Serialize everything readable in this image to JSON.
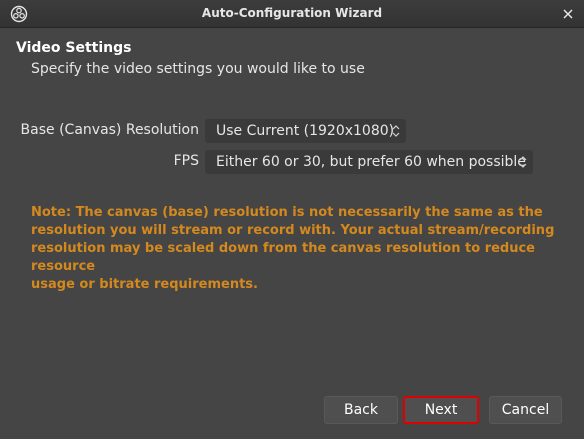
{
  "window": {
    "title": "Auto-Configuration Wizard"
  },
  "icons": {
    "app": "obs-logo-icon",
    "close": "close-icon",
    "combo_arrows": "updown-chevron-icon"
  },
  "page": {
    "title": "Video Settings",
    "description": "Specify the video settings you would like to use"
  },
  "form": {
    "resolution_label": "Base (Canvas) Resolution",
    "resolution_value": "Use Current (1920x1080)",
    "fps_label": "FPS",
    "fps_value": "Either 60 or 30, but prefer 60 when possible"
  },
  "note": {
    "lines": [
      "Note: The canvas (base) resolution is not necessarily the same as the",
      "resolution you will stream or record with. Your actual stream/recording",
      "resolution may be scaled down from the canvas resolution to reduce resource",
      "usage or bitrate requirements."
    ],
    "color": "#d4891e"
  },
  "buttons": {
    "back": "Back",
    "next": "Next",
    "cancel": "Cancel"
  },
  "colors": {
    "background": "#454545",
    "highlight_border": "#e00000"
  }
}
